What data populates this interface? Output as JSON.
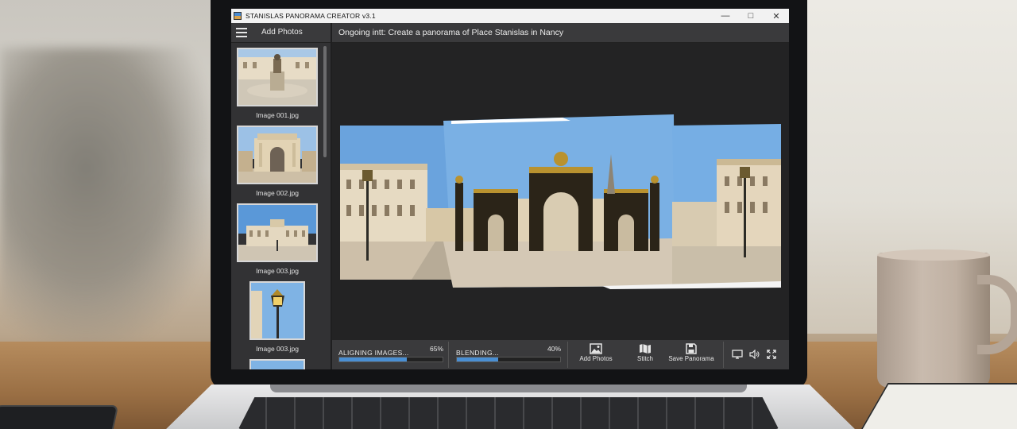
{
  "app": {
    "title": "STANISLAS PANORAMA CREATOR v3.1"
  },
  "toolbar": {
    "tab_label": "Add Photos",
    "status": "Ongoing intt: Create a panorama of Place Stanislas in Nancy"
  },
  "sidebar": {
    "items": [
      {
        "label": "Image 001.jpg"
      },
      {
        "label": "Image 002.jpg"
      },
      {
        "label": "Image 003.jpg"
      },
      {
        "label": "Image 003.jpg"
      }
    ]
  },
  "progress": [
    {
      "label": "ALIGNING IMAGES...",
      "percent_text": "65%",
      "value": 0.65
    },
    {
      "label": "BLENDING...",
      "percent_text": "40%",
      "value": 0.4
    }
  ],
  "actions": {
    "add_photos": "Add Photos",
    "stitch": "Stitch",
    "save_panorama": "Save Panorama"
  },
  "icons": {
    "menu": "hamburger-icon",
    "add": "image-icon",
    "stitch": "map-icon",
    "save": "floppy-icon",
    "monitor": "monitor-icon",
    "volume": "speaker-icon",
    "fullscreen": "fullscreen-icon"
  },
  "colors": {
    "accent": "#4a8fd3",
    "panel": "#3a3a3c",
    "canvas": "#232324"
  }
}
